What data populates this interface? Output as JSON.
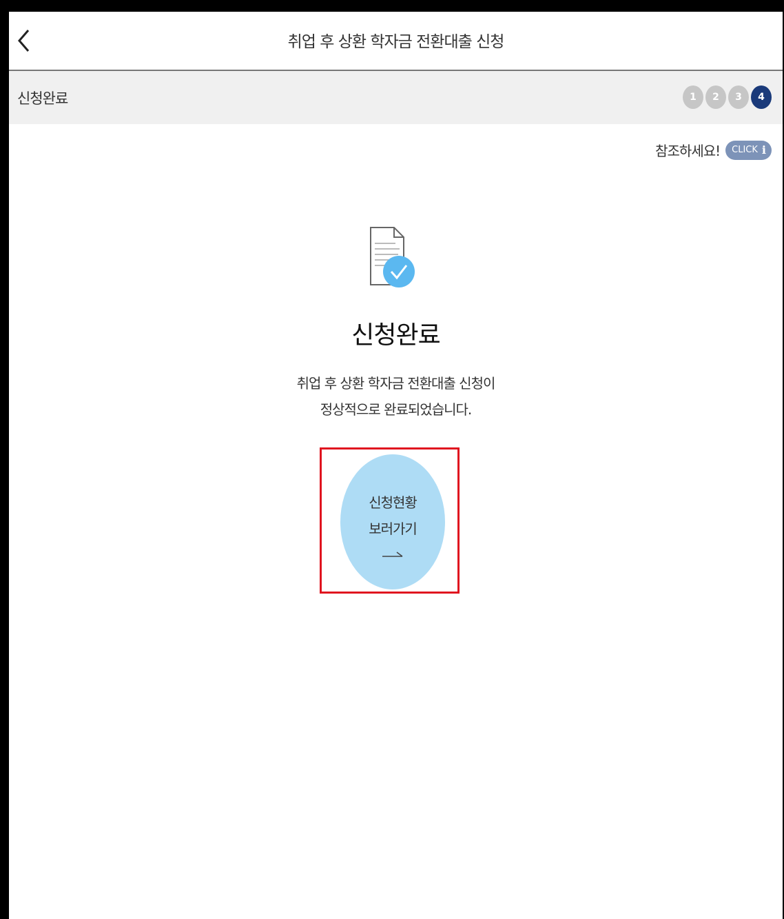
{
  "header": {
    "title": "취업 후 상환 학자금 전환대출 신청"
  },
  "stepbar": {
    "label": "신청완료",
    "steps": [
      "1",
      "2",
      "3",
      "4"
    ],
    "active_step": 4
  },
  "help": {
    "text": "참조하세요!",
    "badge_label": "CLICK",
    "badge_icon": "info-icon"
  },
  "completion": {
    "title": "신청완료",
    "desc_line1": "취업 후 상환 학자금 전환대출 신청이",
    "desc_line2": "정상적으로 완료되었습니다."
  },
  "status_button": {
    "line1": "신청현황",
    "line2": "보러가기"
  },
  "colors": {
    "active_step": "#1a3a7a",
    "inactive_step": "#c6c6c6",
    "button_bg": "#aedcf5",
    "check_circle": "#5bb8f0",
    "highlight": "#e0131f"
  }
}
